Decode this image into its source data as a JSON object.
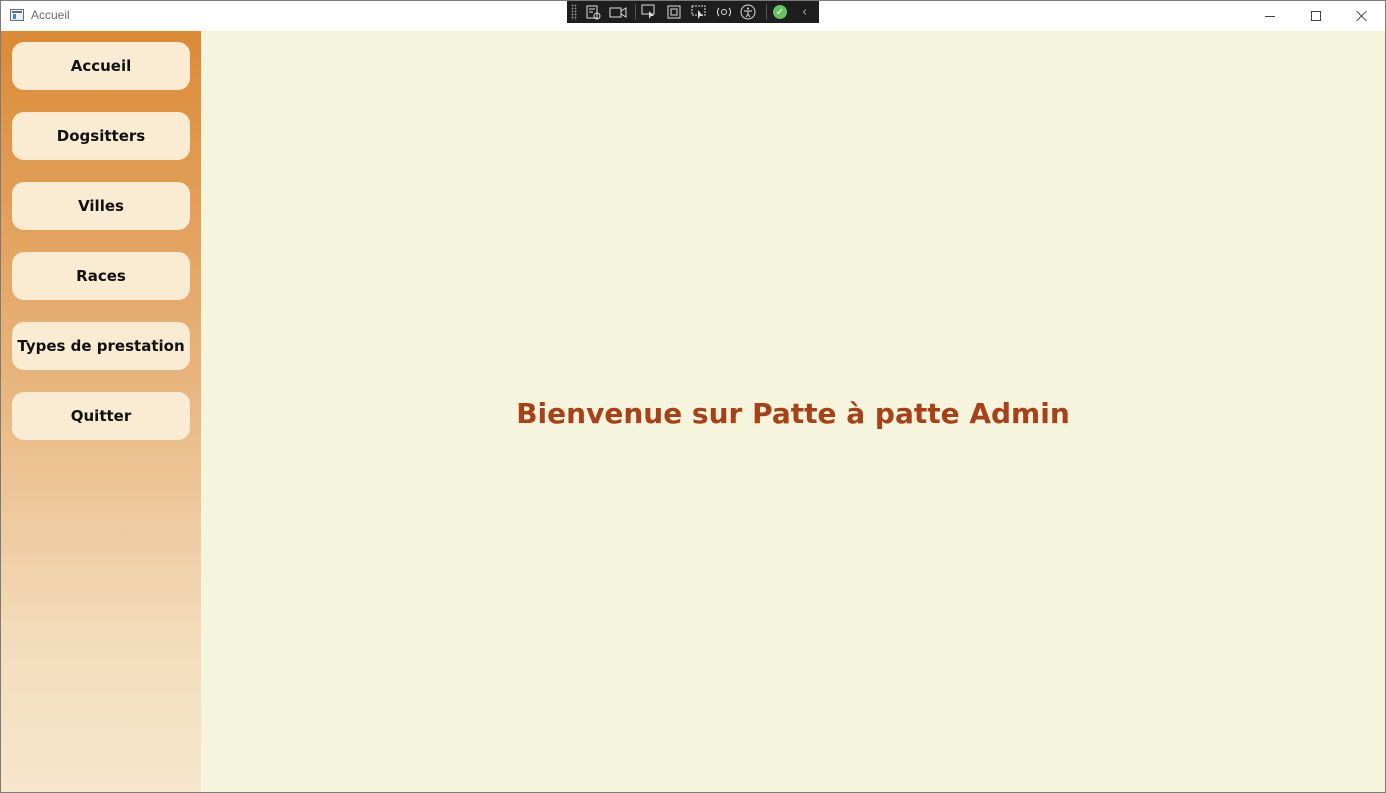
{
  "window": {
    "title": "Accueil"
  },
  "debug_toolbar": {
    "icons": [
      "live-visual-tree-icon",
      "camera-icon",
      "select-element-icon",
      "layout-adorner-icon",
      "track-focus-icon",
      "hot-reload-icon",
      "accessibility-icon",
      "status-ok-icon",
      "collapse-chevron-icon"
    ]
  },
  "sidebar": {
    "items": [
      {
        "label": "Accueil"
      },
      {
        "label": "Dogsitters"
      },
      {
        "label": "Villes"
      },
      {
        "label": "Races"
      },
      {
        "label": "Types de prestation"
      },
      {
        "label": "Quitter"
      }
    ]
  },
  "main": {
    "welcome": "Bienvenue sur Patte à patte Admin"
  },
  "colors": {
    "accent": "#db8a35",
    "button_bg": "#faebd3",
    "content_bg": "#f5f4dc",
    "welcome_text": "#a84117"
  }
}
